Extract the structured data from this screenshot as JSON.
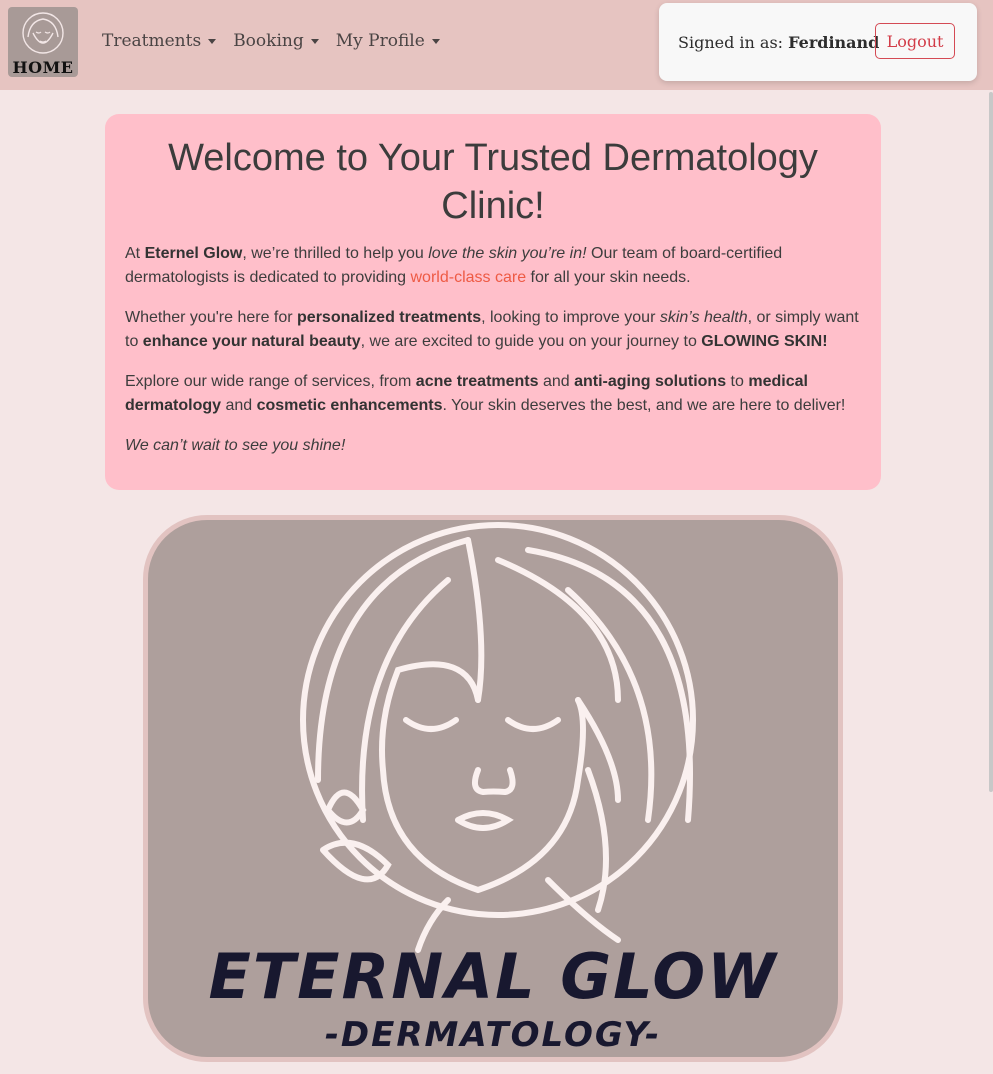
{
  "nav": {
    "home_label": "HOME",
    "menu": [
      "Treatments",
      "Booking",
      "My Profile"
    ]
  },
  "user": {
    "signed_prefix": "Signed in as:",
    "name": "Ferdinand",
    "logout_label": "Logout"
  },
  "welcome": {
    "title": "Welcome to Your Trusted Dermatology Clinic!",
    "p1": {
      "a": "At ",
      "brand": "Eternel Glow",
      "b": ", we’re thrilled to help you ",
      "em": "love the skin you’re in!",
      "c": " Our team of board-certified dermatologists is dedicated to providing ",
      "link": "world-class care",
      "d": " for all your skin needs."
    },
    "p2": {
      "a": "Whether you're here for ",
      "b1": "personalized treatments",
      "b": ", looking to improve your ",
      "em": "skin’s health",
      "c": ", or simply want to ",
      "b2": "enhance your natural beauty",
      "d": ", we are excited to guide you on your journey to ",
      "b3": "GLOWING SKIN",
      "e": "!"
    },
    "p3": {
      "a": "Explore our wide range of services, from ",
      "b1": "acne treatments",
      "b": " and ",
      "b2": "anti-aging solutions",
      "c": " to ",
      "b3": "medical dermatology",
      "d": " and ",
      "b4": "cosmetic enhancements",
      "e": ". Your skin deserves the best, and we are here to deliver!"
    },
    "p4": "We can’t wait to see you shine!"
  },
  "hero_logo": {
    "line1": "ETERNAL  GLOW",
    "line2": "-DERMATOLOGY-"
  }
}
